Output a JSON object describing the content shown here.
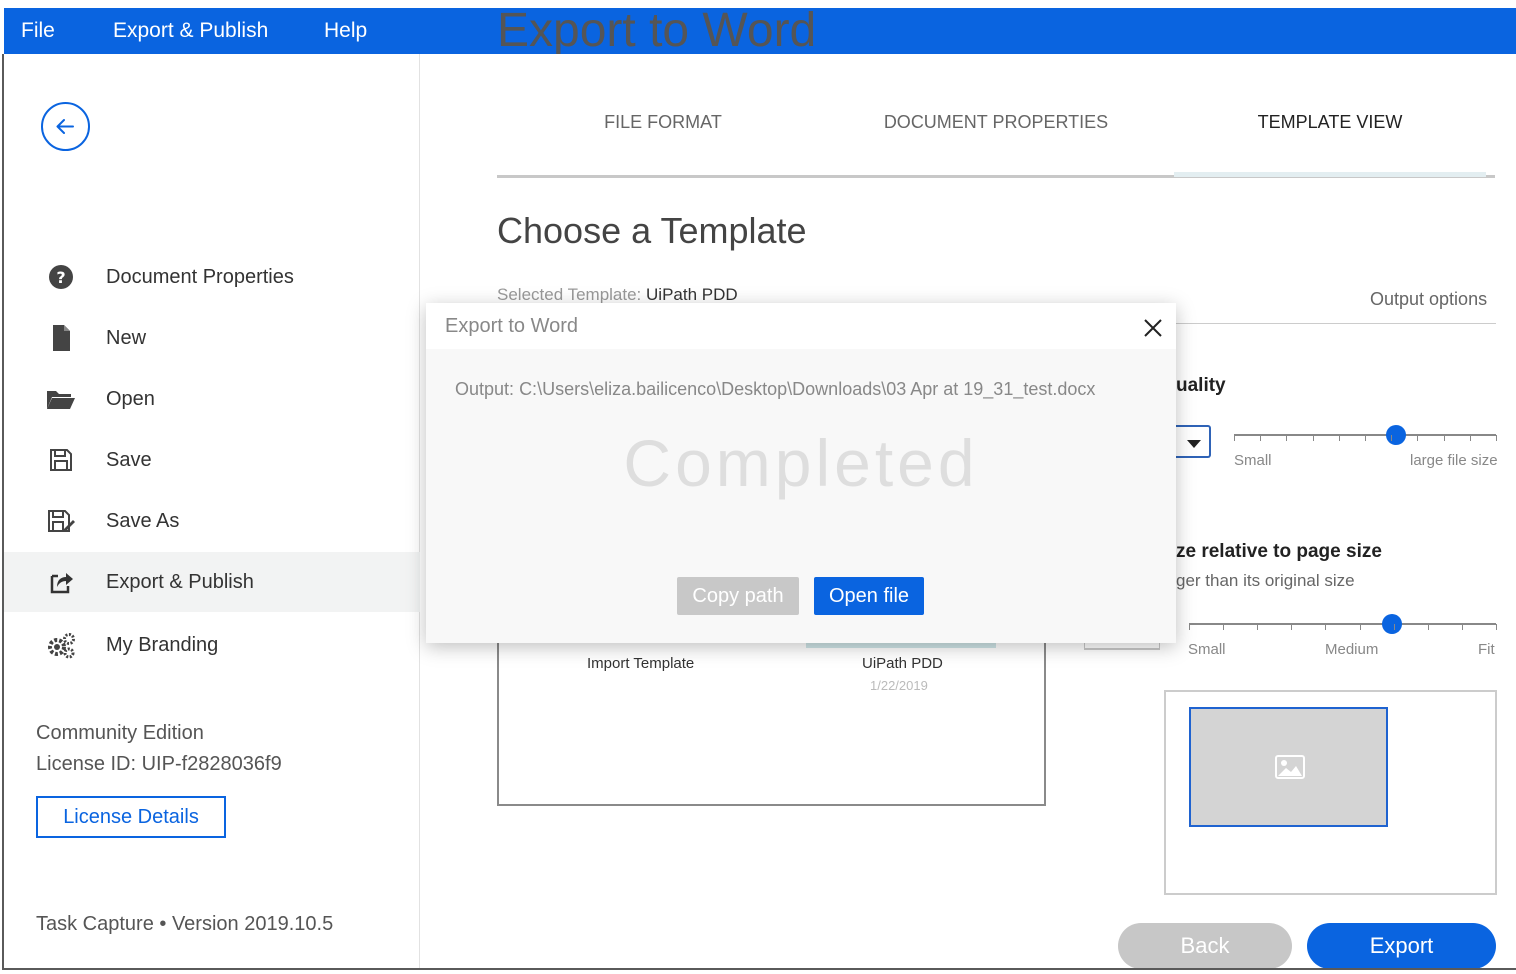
{
  "menu": {
    "file": "File",
    "export_publish": "Export & Publish",
    "help": "Help"
  },
  "sidebar": {
    "items": [
      {
        "label": "Document Properties",
        "icon": "question-circle-icon"
      },
      {
        "label": "New",
        "icon": "file-icon"
      },
      {
        "label": "Open",
        "icon": "folder-open-icon"
      },
      {
        "label": "Save",
        "icon": "floppy-disk-icon"
      },
      {
        "label": "Save As",
        "icon": "save-as-icon"
      },
      {
        "label": "Export & Publish",
        "icon": "share-icon",
        "active": true
      },
      {
        "label": "My Branding",
        "icon": "gears-icon"
      }
    ],
    "edition": "Community Edition",
    "license_id": "License ID: UIP-f2828036f9",
    "license_button": "License Details",
    "version": "Task Capture • Version 2019.10.5"
  },
  "main": {
    "page_title": "Export to Word",
    "tabs": [
      {
        "label": "FILE FORMAT"
      },
      {
        "label": "DOCUMENT PROPERTIES"
      },
      {
        "label": "TEMPLATE VIEW",
        "active": true
      }
    ],
    "choose_title": "Choose a Template",
    "selected_template_label": "Selected Template:",
    "selected_template_value": "UiPath PDD",
    "output_options": "Output options",
    "quality_heading": "uality",
    "quality_slider": {
      "min_label": "Small",
      "max_label": "large file size",
      "value": 0.62
    },
    "size_heading": "ze relative to page size",
    "size_sub": "ger than its original size",
    "size_slider": {
      "labels": [
        "Small",
        "Medium",
        "Fit"
      ],
      "value": 0.66
    },
    "templates": [
      {
        "name": "Import Template"
      },
      {
        "name": "UiPath PDD",
        "date": "1/22/2019"
      }
    ],
    "back_button": "Back",
    "export_button": "Export"
  },
  "modal": {
    "title": "Export to Word",
    "output_label": "Output:",
    "output_path": "C:\\Users\\eliza.bailicenco\\Desktop\\Downloads\\03 Apr at 19_31_test.docx",
    "status": "Completed",
    "copy_path": "Copy path",
    "open_file": "Open file"
  },
  "colors": {
    "accent": "#0a64e0",
    "disabled": "#c7c7c7"
  }
}
